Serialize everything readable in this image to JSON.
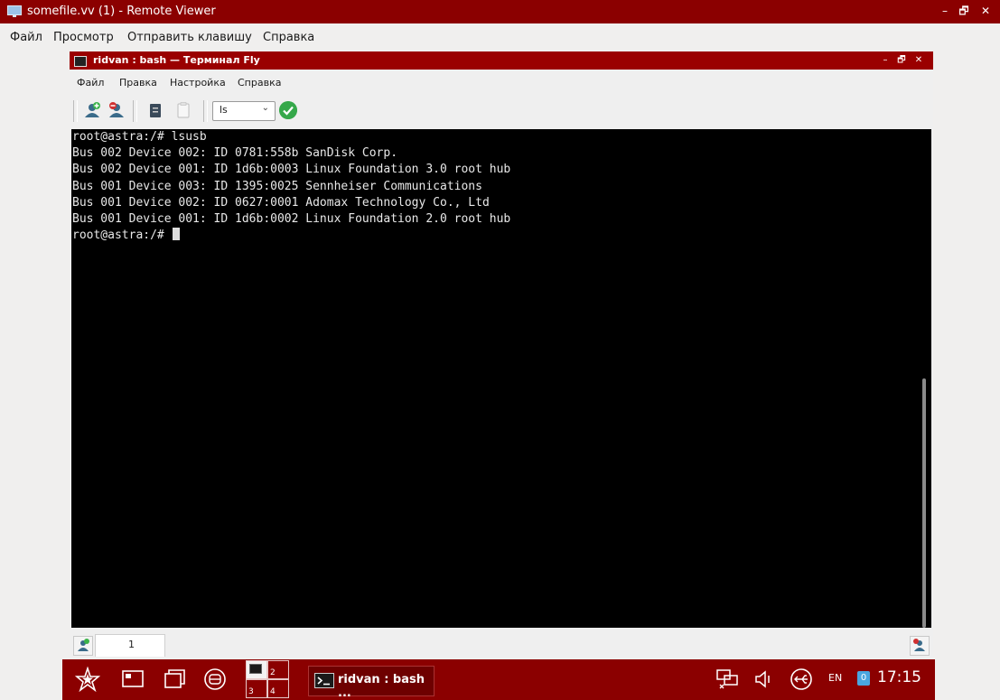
{
  "outer_window": {
    "title": "somefile.vv (1) - Remote Viewer",
    "menu": [
      "Файл",
      "Просмотр",
      "Отправить клавишу",
      "Справка"
    ],
    "controls": [
      "–",
      "🗗",
      "✕"
    ]
  },
  "inner_window": {
    "title": "ridvan : bash — Терминал Fly",
    "controls": [
      "–",
      "🗗",
      "✕"
    ],
    "menu": [
      "Файл",
      "Правка",
      "Настройка",
      "Справка"
    ],
    "command_select": {
      "value": "ls"
    },
    "terminal_lines": [
      "root@astra:/# lsusb",
      "Bus 002 Device 002: ID 0781:558b SanDisk Corp.",
      "Bus 002 Device 001: ID 1d6b:0003 Linux Foundation 3.0 root hub",
      "Bus 001 Device 003: ID 1395:0025 Sennheiser Communications",
      "Bus 001 Device 002: ID 0627:0001 Adomax Technology Co., Ltd",
      "Bus 001 Device 001: ID 1d6b:0002 Linux Foundation 2.0 root hub",
      "root@astra:/# "
    ],
    "tabs": [
      {
        "label": "1"
      }
    ]
  },
  "taskbar": {
    "workspaces": [
      "1",
      "2",
      "3",
      "4"
    ],
    "window_button": "ridvan : bash ...",
    "language": "EN",
    "notification_count": "0",
    "clock": "17:15"
  }
}
